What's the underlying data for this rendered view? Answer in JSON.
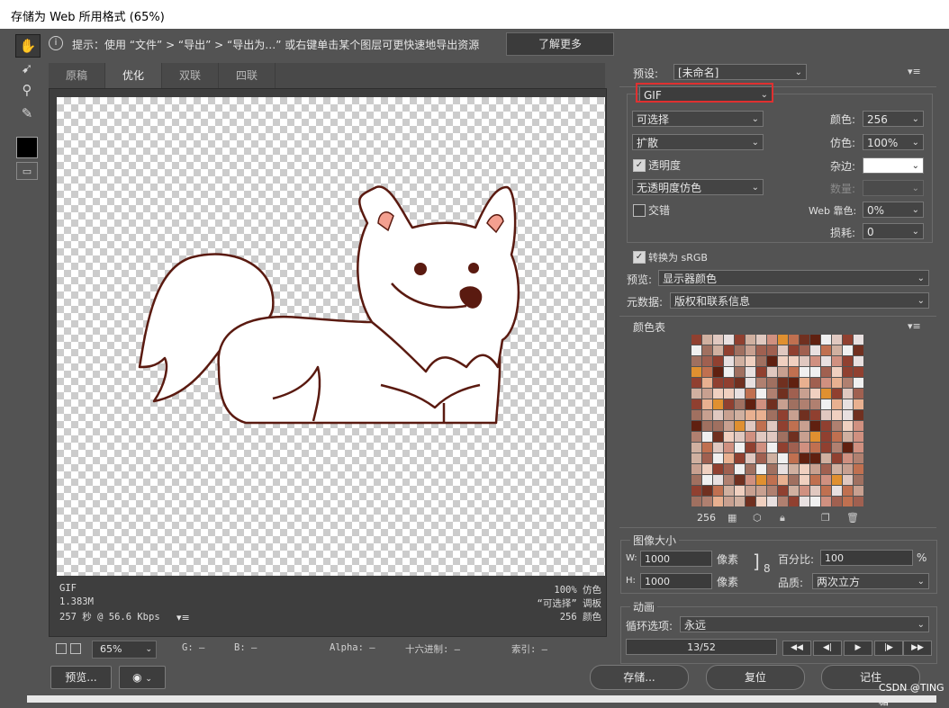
{
  "window": {
    "title": "存储为 Web 所用格式 (65%)"
  },
  "hint": {
    "text": "提示：使用 “文件” > “导出” > “导出为…” 或右键单击某个图层可更快速地导出资源",
    "learn_more": "了解更多"
  },
  "tabs": [
    "原稿",
    "优化",
    "双联",
    "四联"
  ],
  "active_tab": "优化",
  "preview_info": {
    "format": "GIF",
    "size": "1.383M",
    "time": "257 秒 @ 56.6 Kbps",
    "dither": "100% 仿色",
    "palette_desc": "“可选择” 调板",
    "colors": "256 颜色"
  },
  "statusbar": {
    "zoom": "65%",
    "g": "G: —",
    "b": "B: —",
    "alpha": "Alpha: —",
    "hex": "十六进制: —",
    "index": "索引: —"
  },
  "bottom_buttons": {
    "preview": "预览...",
    "save": "存储...",
    "reset": "复位",
    "remember": "记住"
  },
  "watermark": "CSDN @TING糖",
  "settings": {
    "preset_label": "预设:",
    "preset_value": "[未命名]",
    "format": "GIF",
    "reduction": "可选择",
    "dither_algo": "扩散",
    "transparency_label": "透明度",
    "transparency_checked": true,
    "trans_dither": "无透明度仿色",
    "interlaced_label": "交错",
    "interlaced_checked": false,
    "colors_label": "颜色:",
    "colors_value": "256",
    "dither_label": "仿色:",
    "dither_value": "100%",
    "matte_label": "杂边:",
    "amount_label": "数量:",
    "web_snap_label": "Web 靠色:",
    "web_snap_value": "0%",
    "lossy_label": "损耗:",
    "lossy_value": "0",
    "convert_srgb_label": "转换为 sRGB",
    "convert_srgb_checked": true,
    "preview_label": "预览:",
    "preview_value": "显示器颜色",
    "metadata_label": "元数据:",
    "metadata_value": "版权和联系信息"
  },
  "color_table": {
    "title": "颜色表",
    "count": "256"
  },
  "image_size": {
    "title": "图像大小",
    "w_label": "W:",
    "w_value": "1000",
    "h_label": "H:",
    "h_value": "1000",
    "unit": "像素",
    "percent_label": "百分比:",
    "percent_value": "100",
    "percent_unit": "%",
    "quality_label": "品质:",
    "quality_value": "两次立方"
  },
  "animation": {
    "title": "动画",
    "loop_label": "循环选项:",
    "loop_value": "永远",
    "frame": "13/52"
  },
  "colors": {
    "accent_red": "#e03030",
    "palette": [
      "#c8a090",
      "#e0c8c0",
      "#a07060",
      "#e8e0e0",
      "#703020",
      "#f0d0c0",
      "#c07050",
      "#904030",
      "#d0b0a0",
      "#e09030",
      "#f0f0f0",
      "#b08070",
      "#602010",
      "#e8b090",
      "#d09080",
      "#a06050"
    ]
  }
}
